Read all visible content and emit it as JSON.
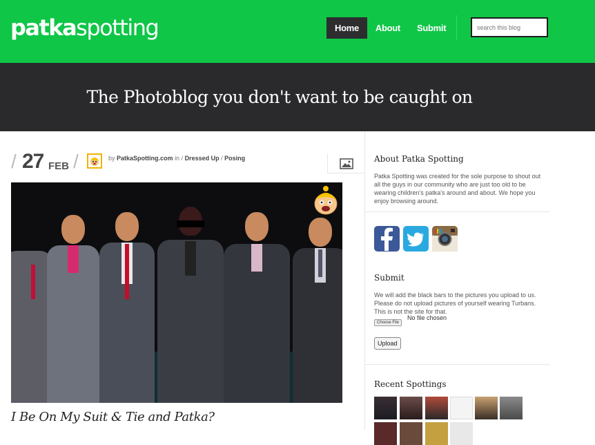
{
  "header": {
    "logo_bold": "patka",
    "logo_light": "spotting",
    "nav": [
      "Home",
      "About",
      "Submit"
    ],
    "active_nav": "Home",
    "search_placeholder": "search this blog"
  },
  "tagline": "The Photoblog you don't want to be caught on",
  "post": {
    "day": "27",
    "month": "FEB",
    "by": "by",
    "author": "PatkaSpotting.com",
    "in": "in /",
    "category1": "Dressed Up",
    "sep": "/",
    "category2": "Posing",
    "title": "I Be On My Suit & Tie and Patka?"
  },
  "sidebar": {
    "about_title": "About Patka Spotting",
    "about_text": "Patka Spotting was created for the sole purpose to shout out all the guys in our community who are just too old to be wearing children's patka's around and about. We hope you enjoy browsing around.",
    "submit_title": "Submit",
    "submit_text": "We will add the black bars to the pictures you upload to us. Please do not upload pictures of yourself wearing Turbans. This is not the site for that.",
    "choose_file": "Choose File",
    "no_file": "No file chosen",
    "upload": "Upload",
    "recent_title": "Recent Spottings"
  },
  "colors": {
    "brand_green": "#0fc647",
    "dark_band": "#2a2a2c",
    "facebook": "#3b5998",
    "twitter": "#2aa9e0"
  },
  "icons": [
    "image-format-icon",
    "patka-face-icon",
    "facebook-icon",
    "twitter-icon",
    "instagram-icon"
  ]
}
